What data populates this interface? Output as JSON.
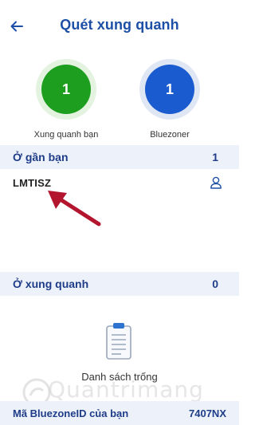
{
  "header": {
    "title": "Quét xung quanh",
    "back_icon": "arrow-left-icon"
  },
  "stats": {
    "nearby": {
      "count": "1",
      "label": "Xung quanh bạn",
      "color": "#1e9e1e"
    },
    "bluezoner": {
      "count": "1",
      "label": "Bluezoner",
      "color": "#1a5bd0"
    }
  },
  "near_section": {
    "label": "Ở gần bạn",
    "count": "1",
    "devices": [
      {
        "name": "LMTISZ",
        "icon": "user-icon"
      }
    ]
  },
  "around_section": {
    "label": "Ở xung quanh",
    "count": "0",
    "empty_text": "Danh sách trống",
    "empty_icon": "clipboard-icon"
  },
  "footer": {
    "label": "Mã BluezoneID của bạn",
    "value": "7407NX"
  },
  "watermark": {
    "text": "Quantrimang"
  },
  "colors": {
    "accent": "#1d4fa6",
    "section_bg": "#edf2fa",
    "annotation_arrow": "#b3152f"
  }
}
